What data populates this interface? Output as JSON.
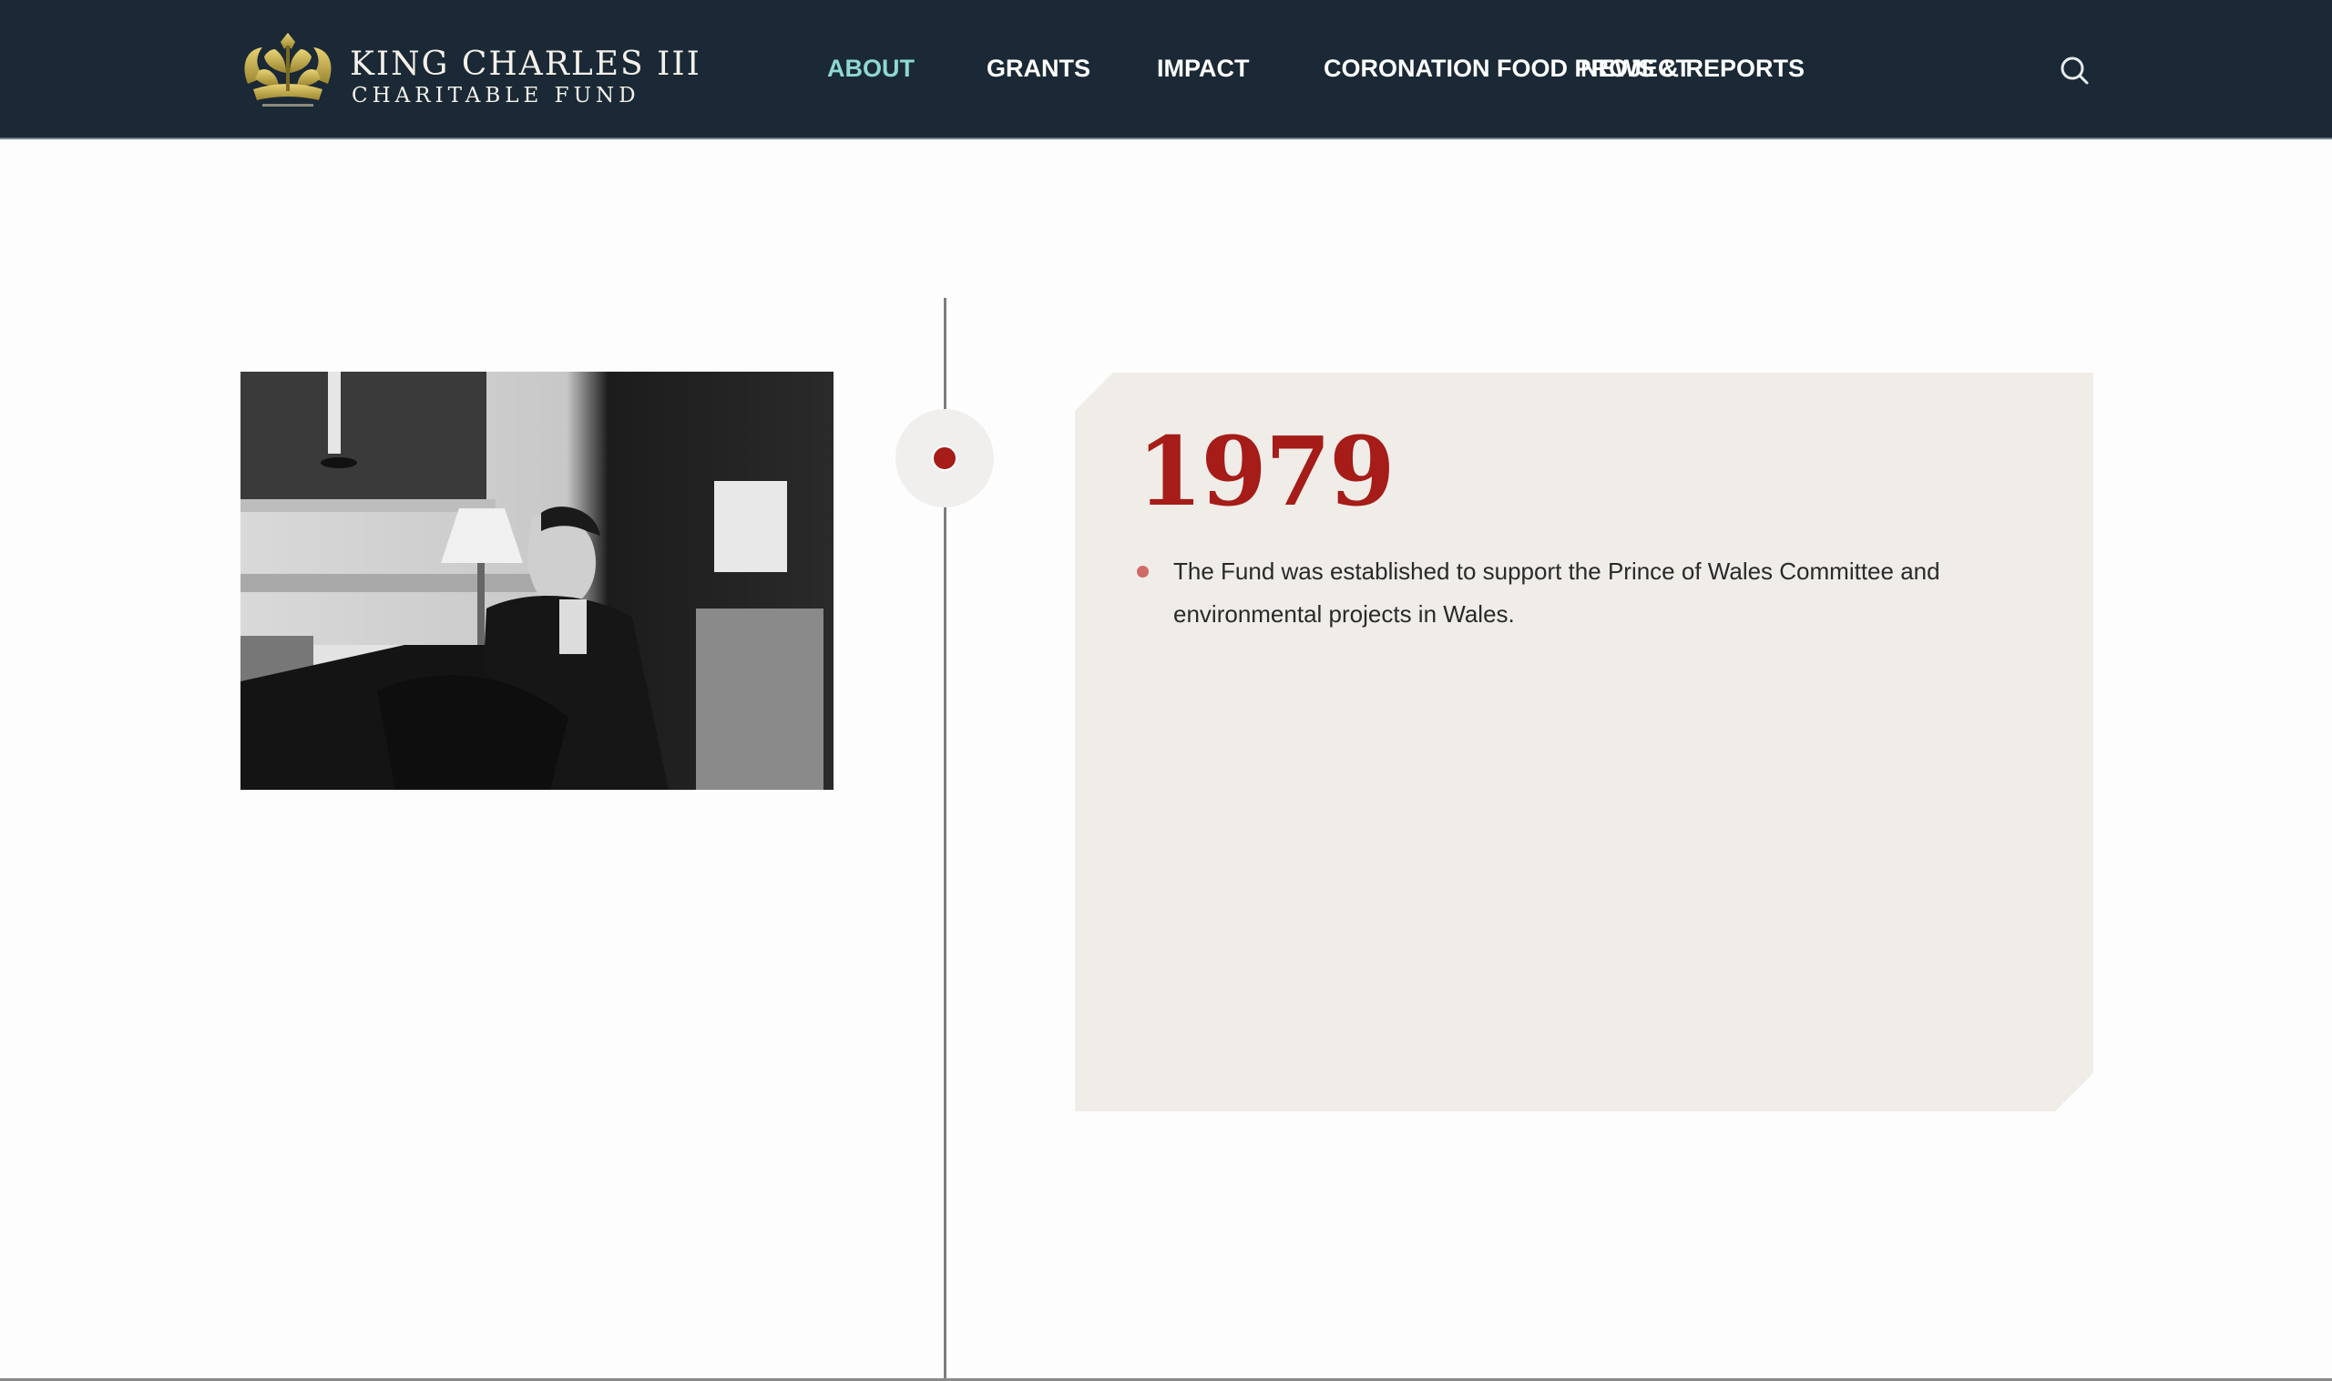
{
  "header": {
    "logo": {
      "line1": "KING CHARLES III",
      "line2": "CHARITABLE FUND",
      "emblem": "crown-icon"
    },
    "nav": [
      {
        "label": "ABOUT",
        "active": true
      },
      {
        "label": "GRANTS",
        "active": false
      },
      {
        "label": "IMPACT",
        "active": false
      },
      {
        "label": "CORONATION FOOD PROJECT",
        "active": false
      },
      {
        "label": "NEWS & REPORTS",
        "active": false
      }
    ],
    "search_icon": "search-icon"
  },
  "colors": {
    "header_bg": "#1a2935",
    "nav_active": "#8fd8d2",
    "accent_red": "#a51c18",
    "card_bg": "#f0ece8"
  },
  "timeline": {
    "entry": {
      "year": "1979",
      "photo_alt": "Black and white photograph of a young Prince Charles seated in an ornate room",
      "bullets": [
        "The Fund was established to support the Prince of Wales Committee and environmental projects in Wales."
      ]
    }
  }
}
